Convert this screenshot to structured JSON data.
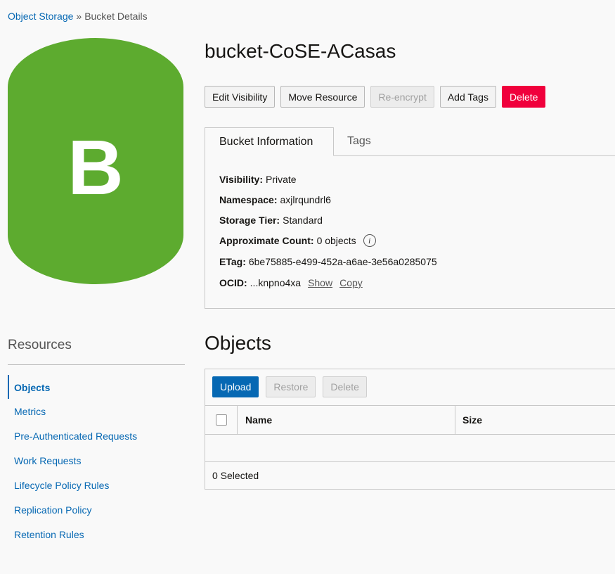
{
  "breadcrumb": {
    "root": "Object Storage",
    "separator": "»",
    "current": "Bucket Details"
  },
  "bucket_icon": {
    "letter": "B",
    "color": "#5dab2f"
  },
  "title": "bucket-CoSE-ACasas",
  "actions": {
    "edit_visibility": "Edit Visibility",
    "move_resource": "Move Resource",
    "re_encrypt": "Re-encrypt",
    "add_tags": "Add Tags",
    "delete": "Delete"
  },
  "tabs": {
    "bucket_information": "Bucket Information",
    "tags": "Tags"
  },
  "info": {
    "visibility_label": "Visibility:",
    "visibility": "Private",
    "namespace_label": "Namespace:",
    "namespace": "axjlrqundrl6",
    "storage_tier_label": "Storage Tier:",
    "storage_tier": "Standard",
    "approx_count_label": "Approximate Count:",
    "approx_count": "0 objects",
    "etag_label": "ETag:",
    "etag": "6be75885-e499-452a-a6ae-3e56a0285075",
    "ocid_label": "OCID:",
    "ocid": "...knpno4xa",
    "show": "Show",
    "copy": "Copy"
  },
  "resources": {
    "title": "Resources",
    "items": [
      {
        "label": "Objects",
        "active": true
      },
      {
        "label": "Metrics"
      },
      {
        "label": "Pre-Authenticated Requests"
      },
      {
        "label": "Work Requests"
      },
      {
        "label": "Lifecycle Policy Rules"
      },
      {
        "label": "Replication Policy"
      },
      {
        "label": "Retention Rules"
      }
    ]
  },
  "objects": {
    "title": "Objects",
    "upload": "Upload",
    "restore": "Restore",
    "delete": "Delete",
    "columns": {
      "name": "Name",
      "size": "Size"
    },
    "selected": "0 Selected"
  },
  "colors": {
    "link": "#0668b3",
    "danger": "#f0003c",
    "primary": "#0668b3"
  }
}
